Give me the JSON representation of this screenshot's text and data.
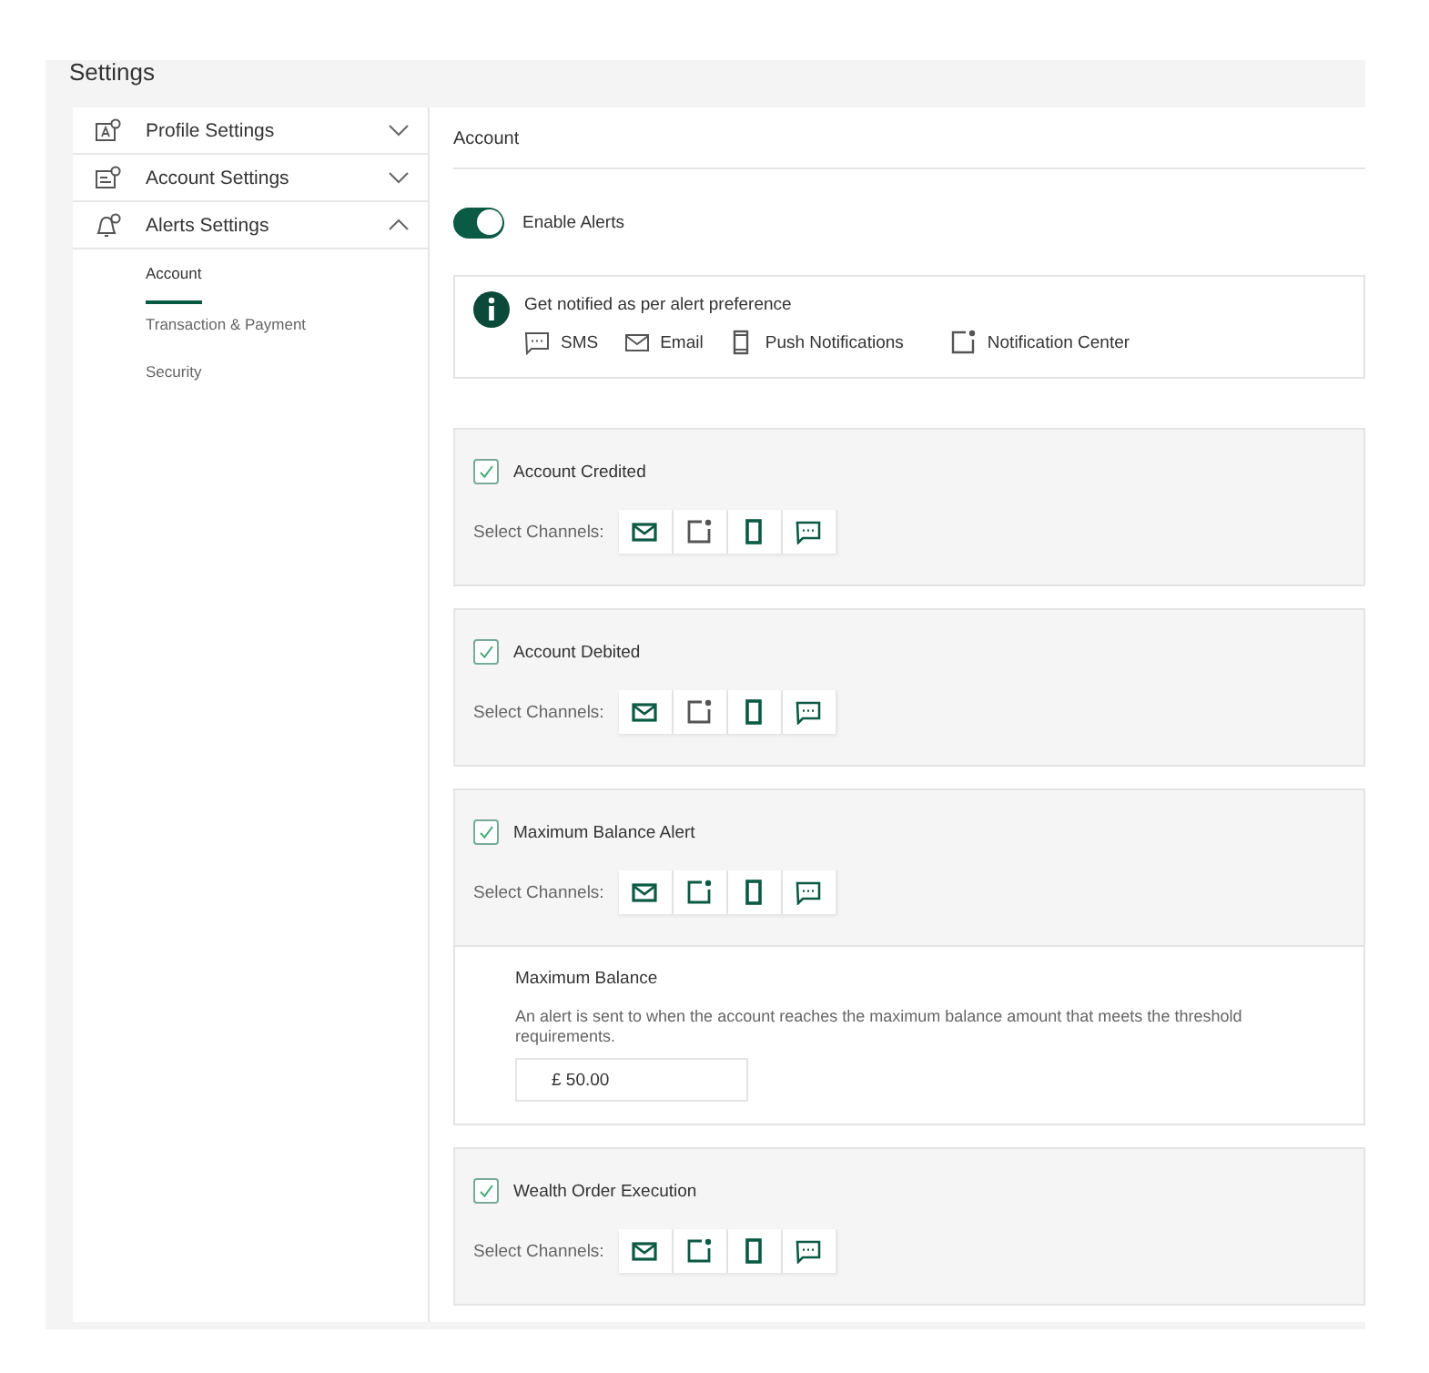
{
  "title": "Settings",
  "sidebar": {
    "items": [
      {
        "label": "Profile Settings",
        "kind": "profile",
        "expanded": false
      },
      {
        "label": "Account Settings",
        "kind": "account",
        "expanded": false
      },
      {
        "label": "Alerts Settings",
        "kind": "alerts",
        "expanded": true,
        "children": [
          {
            "label": "Account",
            "selected": true
          },
          {
            "label": "Transaction & Payment",
            "selected": false
          },
          {
            "label": "Security",
            "selected": false
          }
        ]
      }
    ]
  },
  "content": {
    "heading": "Account",
    "enable_alerts": {
      "label": "Enable Alerts",
      "on": true
    },
    "info": {
      "text": "Get notified as per alert preference",
      "channels": [
        {
          "kind": "sms",
          "label": "SMS"
        },
        {
          "kind": "email",
          "label": "Email"
        },
        {
          "kind": "push",
          "label": "Push Notifications"
        },
        {
          "kind": "center",
          "label": "Notification Center"
        }
      ]
    },
    "cards": [
      {
        "title": "Account Credited",
        "checked": true,
        "channels_label": "Select Channels:",
        "channels": [
          {
            "kind": "email",
            "selected": true
          },
          {
            "kind": "center",
            "selected": false
          },
          {
            "kind": "push",
            "selected": true
          },
          {
            "kind": "sms",
            "selected": true
          }
        ]
      },
      {
        "title": "Account Debited",
        "checked": true,
        "channels_label": "Select Channels:",
        "channels": [
          {
            "kind": "email",
            "selected": true
          },
          {
            "kind": "center",
            "selected": false
          },
          {
            "kind": "push",
            "selected": true
          },
          {
            "kind": "sms",
            "selected": true
          }
        ]
      },
      {
        "title": "Maximum Balance Alert",
        "checked": true,
        "channels_label": "Select Channels:",
        "channels": [
          {
            "kind": "email",
            "selected": true
          },
          {
            "kind": "center",
            "selected": true
          },
          {
            "kind": "push",
            "selected": true
          },
          {
            "kind": "sms",
            "selected": true
          }
        ],
        "threshold": {
          "title": "Maximum Balance",
          "description": "An alert is sent to when the account reaches the maximum balance amount that meets the threshold requirements.",
          "value": "£ 50.00"
        }
      },
      {
        "title": "Wealth Order Execution",
        "checked": true,
        "channels_label": "Select Channels:",
        "channels": [
          {
            "kind": "email",
            "selected": true
          },
          {
            "kind": "center",
            "selected": true
          },
          {
            "kind": "push",
            "selected": true
          },
          {
            "kind": "sms",
            "selected": true
          }
        ]
      }
    ]
  }
}
